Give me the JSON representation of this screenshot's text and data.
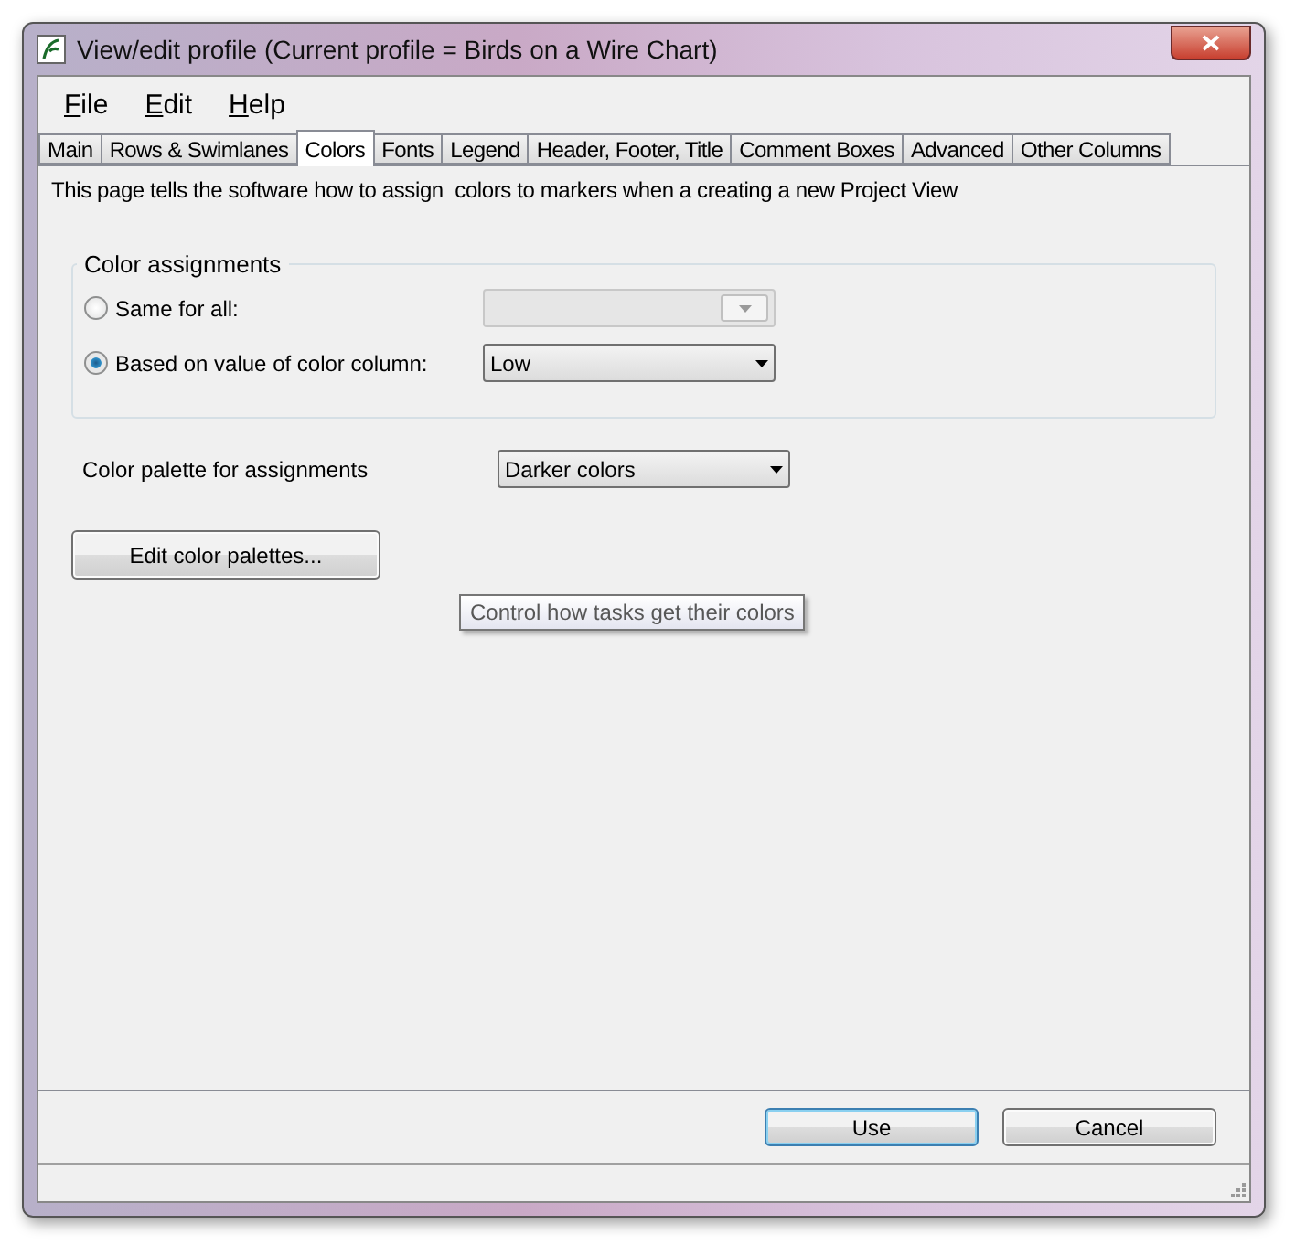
{
  "window": {
    "title": "View/edit profile (Current profile = Birds on a Wire Chart)"
  },
  "menu": [
    "File",
    "Edit",
    "Help"
  ],
  "tabs": [
    {
      "label": "Main",
      "selected": false
    },
    {
      "label": "Rows & Swimlanes",
      "selected": false
    },
    {
      "label": "Colors",
      "selected": true
    },
    {
      "label": "Fonts",
      "selected": false
    },
    {
      "label": "Legend",
      "selected": false
    },
    {
      "label": "Header, Footer, Title",
      "selected": false
    },
    {
      "label": "Comment Boxes",
      "selected": false
    },
    {
      "label": "Advanced",
      "selected": false
    },
    {
      "label": "Other Columns",
      "selected": false
    }
  ],
  "description": "This page tells the software how to assign  colors to markers when a creating a new Project View",
  "color_assignments": {
    "title": "Color assignments",
    "options": [
      {
        "label": "Same for all:",
        "selected": false,
        "disabled": true
      },
      {
        "label": "Based on value of color column:",
        "selected": true,
        "disabled": false,
        "value": "Low"
      }
    ]
  },
  "palette": {
    "label": "Color palette for assignments",
    "value": "Darker colors"
  },
  "edit_button": "Edit color palettes...",
  "tooltip": "Control how tasks get their colors",
  "buttons": [
    {
      "label": "Use",
      "selected": true
    },
    {
      "label": "Cancel",
      "selected": false
    }
  ]
}
